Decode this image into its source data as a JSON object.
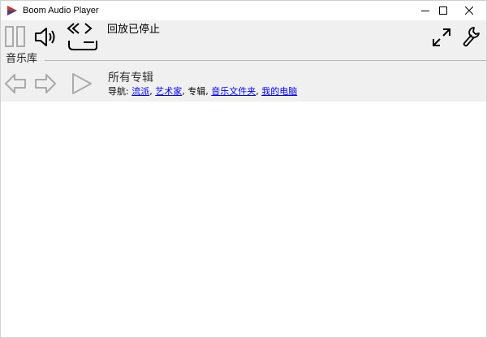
{
  "window": {
    "title": "Boom Audio Player",
    "controls": [
      "minimize",
      "maximize",
      "close"
    ]
  },
  "toolbar": {
    "status": "回放已停止",
    "icons": [
      "pause-icon",
      "volume-icon",
      "repeat-icon",
      "fullscreen-icon",
      "settings-icon"
    ]
  },
  "library": {
    "section_label": "音乐库",
    "current_title": "所有专辑",
    "nav_label": "导航: ",
    "nav": [
      {
        "label": "流派",
        "link": true
      },
      {
        "label": "艺术家",
        "link": true
      },
      {
        "label": "专辑",
        "link": false
      },
      {
        "label": "音乐文件夹",
        "link": true
      },
      {
        "label": "我的电脑",
        "link": true
      }
    ],
    "nav_separator": ", "
  },
  "colors": {
    "toolbar_bg": "#f0f0f0",
    "link": "#0000ee",
    "disabled_icon": "#b0b0b0"
  }
}
